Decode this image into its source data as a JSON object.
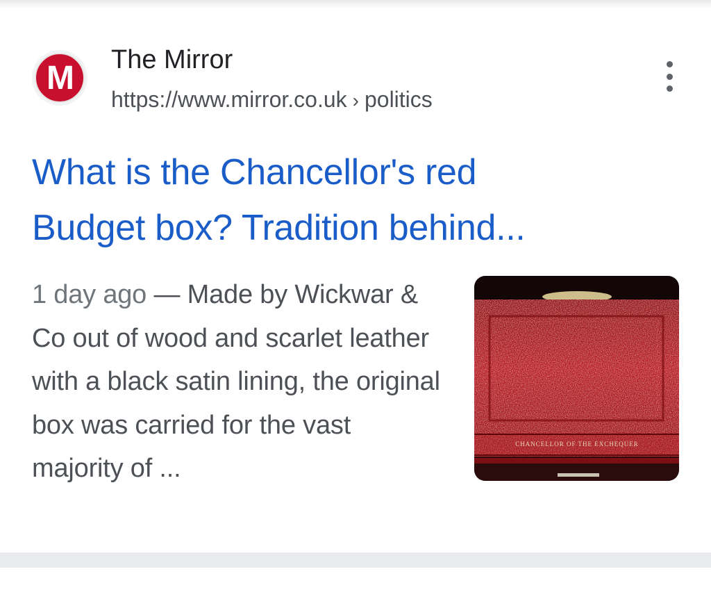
{
  "result": {
    "site_name": "The Mirror",
    "favicon_letter": "M",
    "url_base": "https://www.mirror.co.uk",
    "url_separator": "›",
    "url_path": "politics",
    "title_line1": "What is the Chancellor's red",
    "title_line2": "Budget box? Tradition behind...",
    "date": "1 day ago",
    "date_separator": " — ",
    "snippet": "Made by Wickwar & Co out of wood and scarlet leather with a black satin lining, the original box was carried for the vast majority of ...",
    "thumbnail_caption": "CHANCELLOR OF THE EXCHEQUER",
    "more_icon": "more-vert-icon"
  },
  "colors": {
    "title_link": "#1a5dc9",
    "site_name": "#202124",
    "url": "#4d5156",
    "snippet": "#4d5156",
    "favicon_bg": "#c8102e",
    "box_red": "#b3141c"
  }
}
